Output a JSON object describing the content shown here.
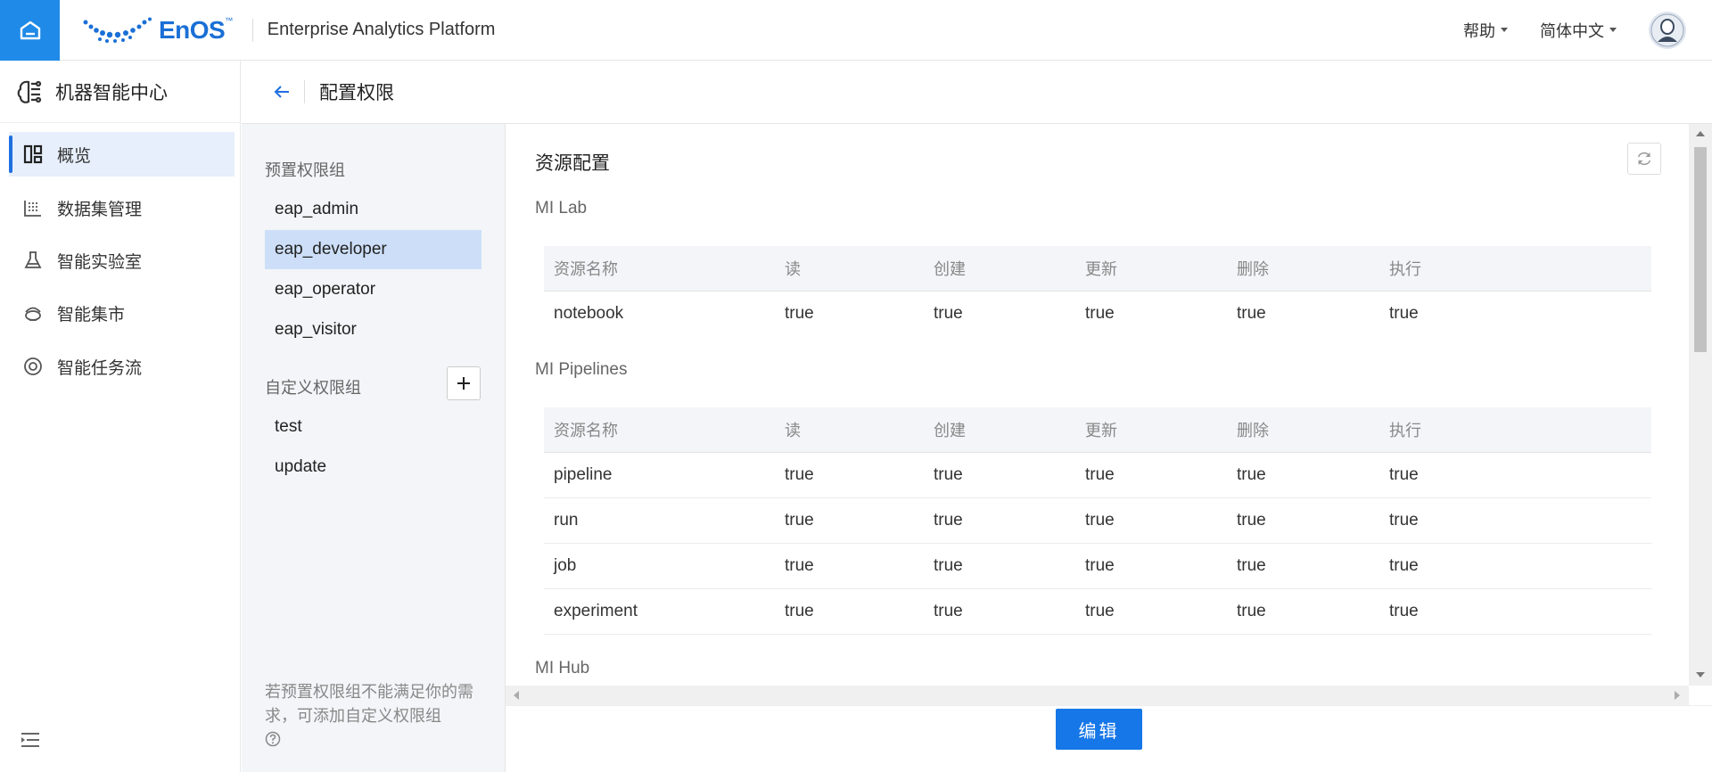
{
  "header": {
    "logo_text": "EnOS",
    "logo_tm": "™",
    "platform_name": "Enterprise Analytics Platform",
    "help_label": "帮助",
    "language_label": "简体中文"
  },
  "sidebar": {
    "title": "机器智能中心",
    "items": [
      {
        "label": "概览",
        "icon": "dashboard-icon",
        "active": true
      },
      {
        "label": "数据集管理",
        "icon": "dataset-icon",
        "active": false
      },
      {
        "label": "智能实验室",
        "icon": "flask-icon",
        "active": false
      },
      {
        "label": "智能集市",
        "icon": "market-icon",
        "active": false
      },
      {
        "label": "智能任务流",
        "icon": "workflow-icon",
        "active": false
      }
    ]
  },
  "page": {
    "title": "配置权限"
  },
  "groups": {
    "preset_title": "预置权限组",
    "preset": [
      "eap_admin",
      "eap_developer",
      "eap_operator",
      "eap_visitor"
    ],
    "selected": "eap_developer",
    "custom_title": "自定义权限组",
    "custom": [
      "test",
      "update"
    ],
    "hint": "若预置权限组不能满足你的需求，可添加自定义权限组"
  },
  "resources": {
    "title": "资源配置",
    "columns": [
      "资源名称",
      "读",
      "创建",
      "更新",
      "删除",
      "执行"
    ],
    "sections": [
      {
        "name": "MI Lab",
        "rows": [
          [
            "notebook",
            "true",
            "true",
            "true",
            "true",
            "true"
          ]
        ]
      },
      {
        "name": "MI Pipelines",
        "rows": [
          [
            "pipeline",
            "true",
            "true",
            "true",
            "true",
            "true"
          ],
          [
            "run",
            "true",
            "true",
            "true",
            "true",
            "true"
          ],
          [
            "job",
            "true",
            "true",
            "true",
            "true",
            "true"
          ],
          [
            "experiment",
            "true",
            "true",
            "true",
            "true",
            "true"
          ]
        ]
      },
      {
        "name": "MI Hub",
        "rows": []
      }
    ]
  },
  "footer": {
    "edit_label": "编辑"
  },
  "colors": {
    "accent": "#1677e8",
    "home_button": "#1f8ae8",
    "selected_group": "#cddff8",
    "active_nav": "#e6effb"
  }
}
